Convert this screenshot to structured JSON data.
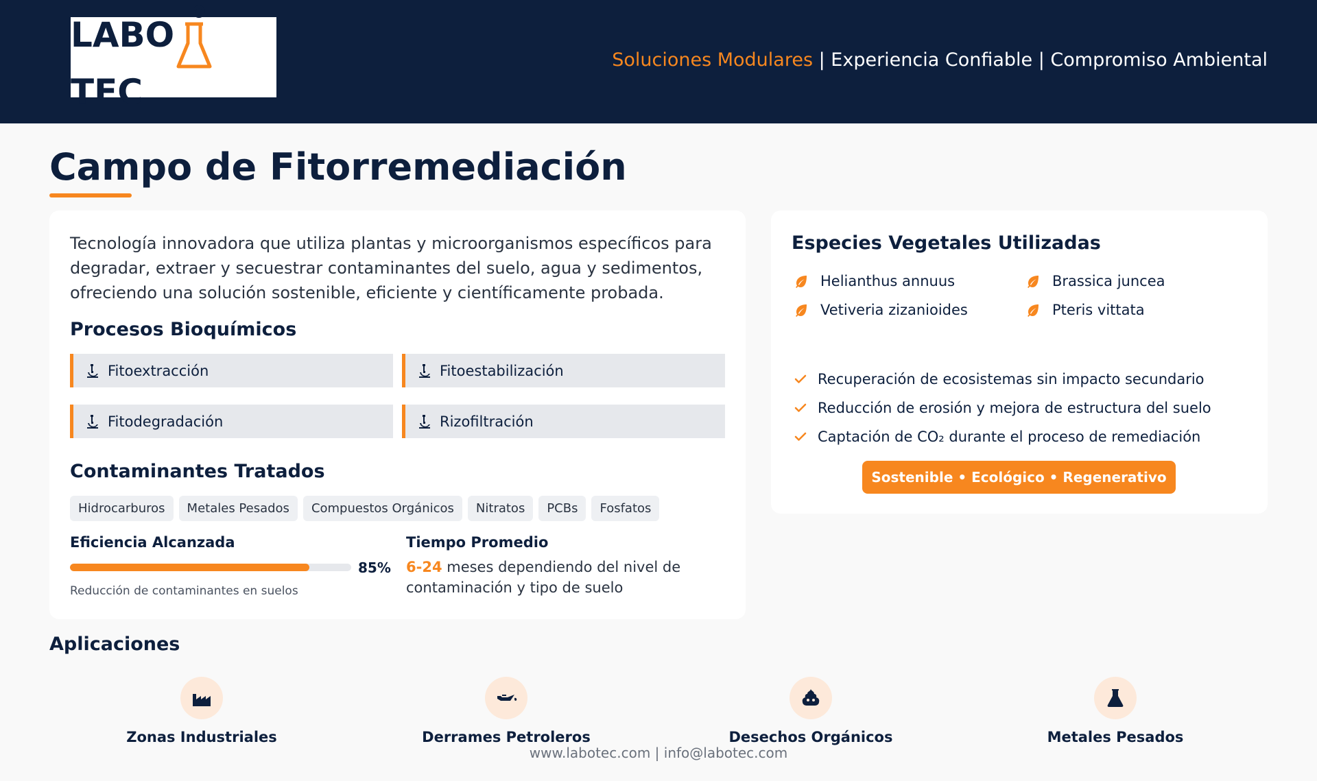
{
  "header": {
    "logo_text_left": "LABO",
    "logo_text_right": "TEC",
    "logo_full": "LABOTEC",
    "tagline_accent": "Soluciones Modulares",
    "tagline_rest": " | Experiencia Confiable | Compromiso Ambiental"
  },
  "page": {
    "title": "Campo de Fitorremediación"
  },
  "intro": "Tecnología innovadora que utiliza plantas y microorganismos específicos para degradar, extraer y secuestrar contaminantes del suelo, agua y sedimentos, ofreciendo una solución sostenible, eficiente y científicamente probada.",
  "processes": {
    "title": "Procesos Bioquímicos",
    "items": [
      {
        "label": "Fitoextracción",
        "icon": "microscope-icon"
      },
      {
        "label": "Fitoestabilización",
        "icon": "microscope-icon"
      },
      {
        "label": "Fitodegradación",
        "icon": "microscope-icon"
      },
      {
        "label": "Rizofiltración",
        "icon": "microscope-icon"
      }
    ]
  },
  "contaminants": {
    "title": "Contaminantes Tratados",
    "tags": [
      "Hidrocarburos",
      "Metales Pesados",
      "Compuestos Orgánicos",
      "Nitratos",
      "PCBs",
      "Fosfatos"
    ]
  },
  "efficiency": {
    "title": "Eficiencia Alcanzada",
    "value_pct": 85,
    "value_label": "85%",
    "note": "Reducción de contaminantes en suelos"
  },
  "time": {
    "title": "Tiempo Promedio",
    "range": "6-24",
    "text": " meses dependiendo del nivel de contaminación y tipo de suelo"
  },
  "species": {
    "title": "Especies Vegetales Utilizadas",
    "items": [
      "Helianthus annuus",
      "Brassica juncea",
      "Vetiveria zizanioides",
      "Pteris vittata"
    ],
    "icon": "leaf-icon"
  },
  "benefits": [
    "Recuperación de ecosistemas sin impacto secundario",
    "Reducción de erosión y mejora de estructura del suelo",
    "Captación de CO₂ durante el proceso de remediación"
  ],
  "badge": "Sostenible • Ecológico • Regenerativo",
  "applications": {
    "title": "Aplicaciones",
    "items": [
      {
        "label": "Zonas Industriales",
        "icon": "industry-icon"
      },
      {
        "label": "Derrames Petroleros",
        "icon": "oil-can-icon"
      },
      {
        "label": "Desechos Orgánicos",
        "icon": "poop-icon"
      },
      {
        "label": "Metales Pesados",
        "icon": "flask-icon"
      }
    ]
  },
  "footer": "www.labotec.com | info@labotec.com",
  "colors": {
    "navy": "#0d1f3d",
    "accent": "#f7871f",
    "background": "#f9f9f9"
  }
}
